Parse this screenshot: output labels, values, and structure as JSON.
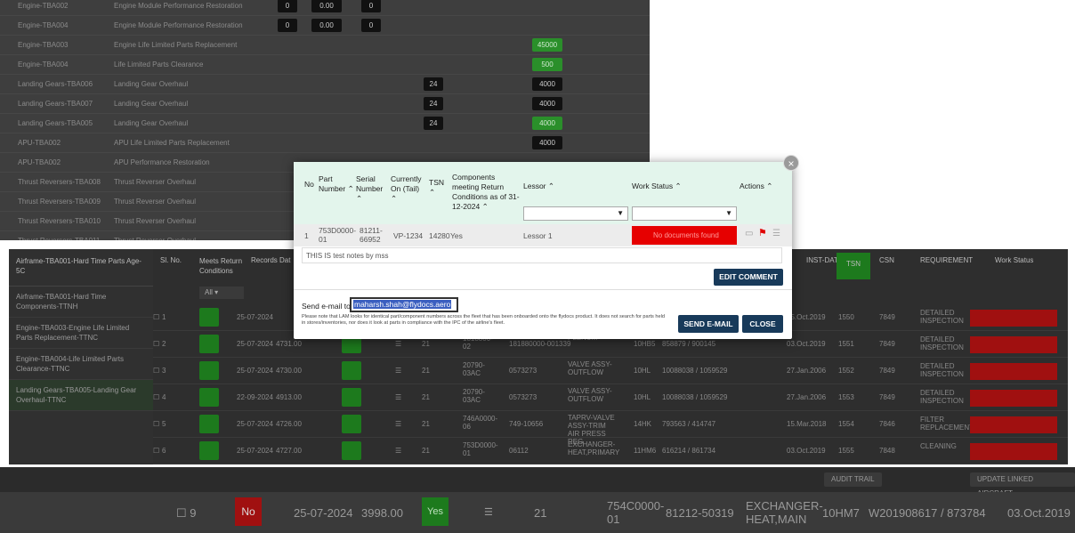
{
  "bg_rows": [
    {
      "a": "Engine-TBA002",
      "b": "Engine Module Performance Restoration",
      "p1": "0",
      "p2": "0.00",
      "p3": "0"
    },
    {
      "a": "Engine-TBA004",
      "b": "Engine Module Performance Restoration",
      "p1": "0",
      "p2": "0.00",
      "p3": "0"
    },
    {
      "a": "Engine-TBA003",
      "b": "Engine Life Limited Parts Replacement",
      "pg": "45000"
    },
    {
      "a": "Engine-TBA004",
      "b": "Life Limited Parts Clearance",
      "pg": "500"
    },
    {
      "a": "Landing Gears-TBA006",
      "b": "Landing Gear Overhaul",
      "p4": "24",
      "pd": "4000"
    },
    {
      "a": "Landing Gears-TBA007",
      "b": "Landing Gear Overhaul",
      "p4": "24",
      "pd": "4000"
    },
    {
      "a": "Landing Gears-TBA005",
      "b": "Landing Gear Overhaul",
      "p4": "24",
      "pg": "4000"
    },
    {
      "a": "APU-TBA002",
      "b": "APU Life Limited Parts Replacement",
      "pd": "4000"
    },
    {
      "a": "APU-TBA002",
      "b": "APU Performance Restoration"
    },
    {
      "a": "Thrust Reversers-TBA008",
      "b": "Thrust Reverser Overhaul"
    },
    {
      "a": "Thrust Reversers-TBA009",
      "b": "Thrust Reverser Overhaul"
    },
    {
      "a": "Thrust Reversers-TBA010",
      "b": "Thrust Reverser Overhaul"
    },
    {
      "a": "Thrust Reversers-TBA011",
      "b": "Thrust Reverser Overhaul"
    }
  ],
  "left_list": {
    "header": "Airframe-TBA001-Hard Time Parts Age-5C",
    "items": [
      "Airframe-TBA001-Hard Time Components-TTNH",
      "Engine-TBA003-Engine Life Limited Parts Replacement-TTNC",
      "Engine-TBA004-Life Limited Parts Clearance-TTNC",
      "Landing Gears-TBA005-Landing Gear Overhaul-TTNC"
    ]
  },
  "main_headers": {
    "sl_no": "Sl. No.",
    "meets": "Meets Return Conditions",
    "records": "Records Dat",
    "inst_date": "INST-DATE",
    "tsn": "TSN",
    "csn": "CSN",
    "requirement": "REQUIREMENT",
    "work_status": "Work Status",
    "filter_all": "All"
  },
  "main_rows": [
    {
      "sl": "1",
      "date": "25-07-2024",
      "num": "",
      "pn": "",
      "sn": "",
      "desc": "",
      "tail": "",
      "serial": "",
      "inst": "05.Oct.2019",
      "tsn": "1550",
      "csn": "7849",
      "req": "DETAILED INSPECTION"
    },
    {
      "sl": "2",
      "date": "25-07-2024",
      "num": "4731.00",
      "pn": "1818800-02",
      "sn": "181880000-001339",
      "desc": "PLENUM",
      "tail": "10HB5",
      "serial": "858879 / 900145",
      "inst": "03.Oct.2019",
      "tsn": "1551",
      "csn": "7849",
      "req": "DETAILED INSPECTION"
    },
    {
      "sl": "3",
      "date": "25-07-2024",
      "num": "4730.00",
      "pn": "20790-03AC",
      "sn": "0573273",
      "desc": "VALVE ASSY-OUTFLOW",
      "tail": "10HL",
      "serial": "10088038 / 1059529",
      "inst": "27.Jan.2006",
      "tsn": "1552",
      "csn": "7849",
      "req": "DETAILED INSPECTION"
    },
    {
      "sl": "4",
      "date": "22-09-2024",
      "num": "4913.00",
      "pn": "20790-03AC",
      "sn": "0573273",
      "desc": "VALVE ASSY-OUTFLOW",
      "tail": "10HL",
      "serial": "10088038 / 1059529",
      "inst": "27.Jan.2006",
      "tsn": "1553",
      "csn": "7849",
      "req": "DETAILED INSPECTION"
    },
    {
      "sl": "5",
      "date": "25-07-2024",
      "num": "4726.00",
      "pn": "746A0000-06",
      "sn": "749-10656",
      "desc": "TAPRV-VALVE ASSY-TRIM AIR PRESS REG",
      "tail": "14HK",
      "serial": "793563 / 414747",
      "inst": "15.Mar.2018",
      "tsn": "1554",
      "csn": "7846",
      "req": "FILTER REPLACEMENT"
    },
    {
      "sl": "6",
      "date": "25-07-2024",
      "num": "4727.00",
      "pn": "753D0000-01",
      "sn": "06112",
      "desc": "EXCHANGER-HEAT,PRIMARY",
      "tail": "11HM6",
      "serial": "616214 / 861734",
      "inst": "03.Oct.2019",
      "tsn": "1555",
      "csn": "7848",
      "req": "CLEANING"
    }
  ],
  "bottom_buttons": {
    "audit": "AUDIT TRAIL",
    "update": "UPDATE LINKED AIRCRAFT"
  },
  "footer_row": {
    "sl": "9",
    "no": "No",
    "date": "25-07-2024",
    "num": "3998.00",
    "yes": "Yes",
    "tsn_val": "21",
    "pn": "754C0000-01",
    "sn": "81212-50319",
    "desc": "EXCHANGER-HEAT,MAIN",
    "tail": "10HM7",
    "serial": "W201908617 / 873784",
    "inst": "03.Oct.2019"
  },
  "modal": {
    "headers": {
      "no": "No",
      "part_number": "Part Number",
      "serial_number": "Serial Number",
      "currently_on": "Currently On (Tail)",
      "tsn": "TSN",
      "components": "Components meeting Return Conditions as of 31-12-2024",
      "lessor": "Lessor",
      "work_status": "Work Status",
      "actions": "Actions"
    },
    "row": {
      "no": "1",
      "part_number": "753D0000-01",
      "serial_number": "81211-66952",
      "tail": "VP-1234",
      "tsn": "14280",
      "meets": "Yes",
      "lessor": "Lessor 1",
      "work_status": "No documents found"
    },
    "notes": "THIS IS test notes by mss",
    "edit_comment": "EDIT COMMENT",
    "send_email_label": "Send e-mail to",
    "email_value": "maharsh.shah@flydocs.aero",
    "disclaimer": "Please note that LAM looks for identical part/component numbers across the fleet that has been onboarded onto the flydocs product. It does not search for parts held in stores/inventories, nor does it look at parts in compliance with the IPC of the airline's fleet.",
    "send_email_btn": "SEND E-MAIL",
    "close_btn": "CLOSE",
    "close_x": "×"
  }
}
